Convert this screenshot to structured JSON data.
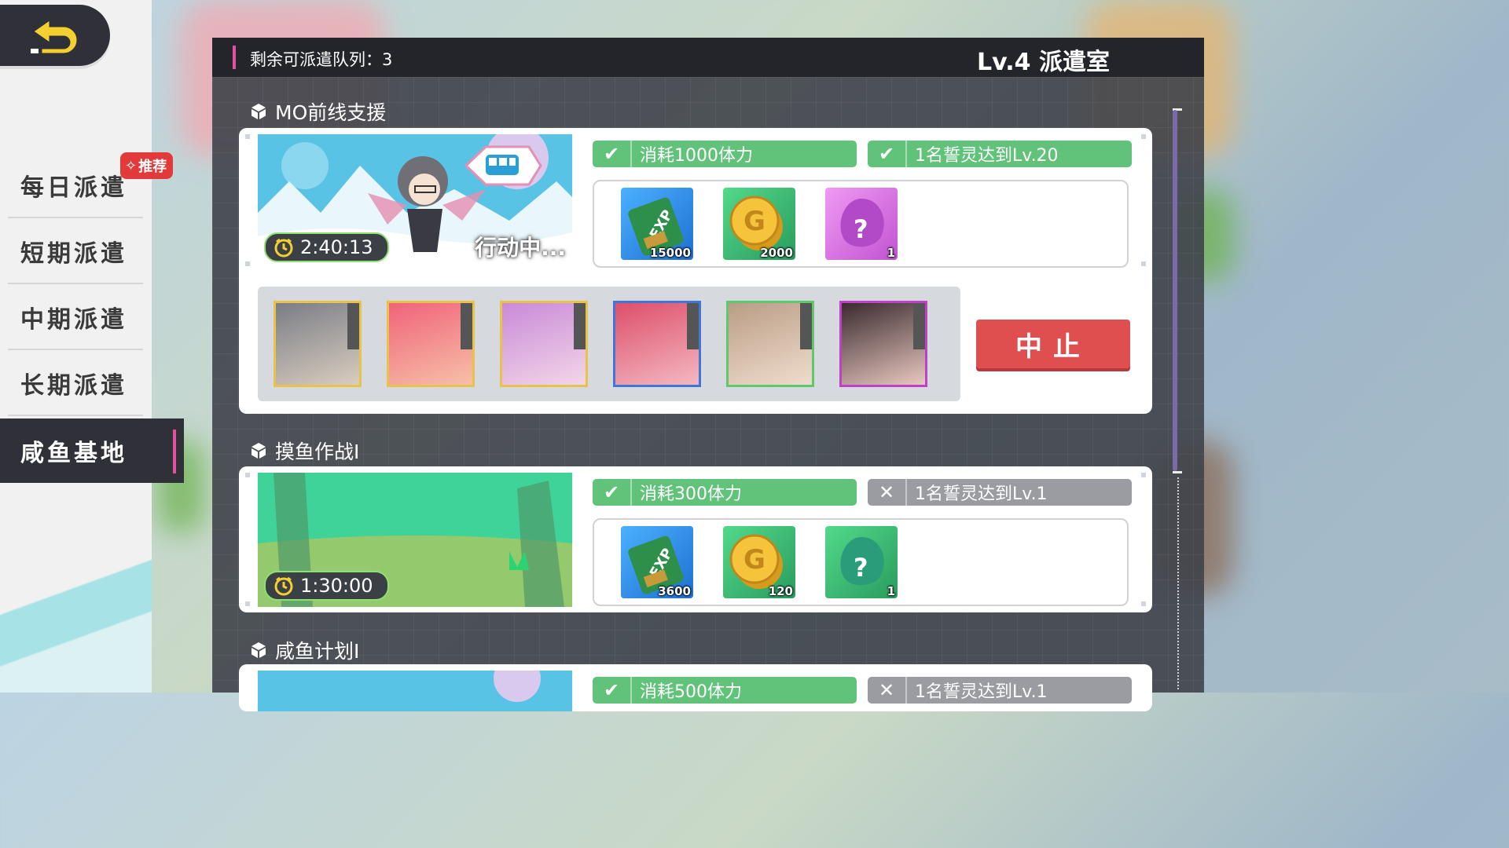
{
  "sidebar": {
    "back_icon": "back-arrow-icon",
    "recommend_badge": "推荐",
    "items": [
      {
        "label": "每日派遣"
      },
      {
        "label": "短期派遣"
      },
      {
        "label": "中期派遣"
      },
      {
        "label": "长期派遣"
      },
      {
        "label": "咸鱼基地",
        "active": true
      }
    ]
  },
  "header": {
    "queue_text": "剩余可派遣队列：3",
    "room_title": "Lv.4 派遣室"
  },
  "missions": [
    {
      "title": "MO前线支援",
      "timer": "2:40:13",
      "status": "行动中...",
      "req1": {
        "text": "消耗1000体力",
        "met": true
      },
      "req2": {
        "text": "1名誓灵达到Lv.20",
        "met": true
      },
      "rewards": [
        {
          "icon": "exp-chip-icon",
          "qty": "15000"
        },
        {
          "icon": "gold-coin-icon",
          "qty": "2000"
        },
        {
          "icon": "mystery-purple-icon",
          "qty": "1"
        }
      ],
      "team_frame_colors": [
        "#e8c24a",
        "#e8c24a",
        "#e8c24a",
        "#3f76d8",
        "#5fc86a",
        "#c040c8"
      ],
      "stop_label": "中止"
    },
    {
      "title": "摸鱼作战I",
      "timer": "1:30:00",
      "req1": {
        "text": "消耗300体力",
        "met": true
      },
      "req2": {
        "text": "1名誓灵达到Lv.1",
        "met": false
      },
      "rewards": [
        {
          "icon": "exp-chip-icon",
          "qty": "3600"
        },
        {
          "icon": "gold-coin-icon",
          "qty": "120"
        },
        {
          "icon": "mystery-green-icon",
          "qty": "1"
        }
      ]
    },
    {
      "title": "咸鱼计划I",
      "req1": {
        "text": "消耗500体力",
        "met": true
      },
      "req2": {
        "text": "1名誓灵达到Lv.1",
        "met": false
      }
    }
  ],
  "colors": {
    "accent_pink": "#e54f9f",
    "ok_green": "#61c27a",
    "fail_grey": "#9a9ca2",
    "stop_red": "#df4f4f"
  }
}
